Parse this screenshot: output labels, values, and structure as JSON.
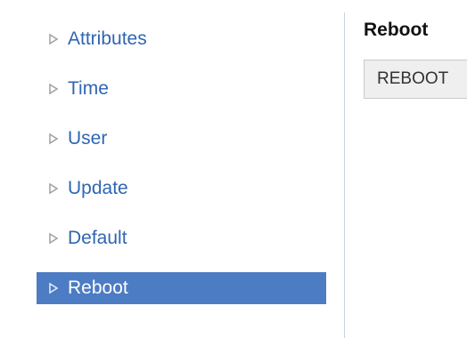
{
  "sidebar": {
    "items": [
      {
        "label": "Attributes",
        "icon": "triangle-right-icon",
        "active": false
      },
      {
        "label": "Time",
        "icon": "triangle-right-icon",
        "active": false
      },
      {
        "label": "User",
        "icon": "triangle-right-icon",
        "active": false
      },
      {
        "label": "Update",
        "icon": "triangle-right-icon",
        "active": false
      },
      {
        "label": "Default",
        "icon": "triangle-right-icon",
        "active": false
      },
      {
        "label": "Reboot",
        "icon": "triangle-right-icon",
        "active": true
      }
    ]
  },
  "main": {
    "title": "Reboot",
    "button_label": "REBOOT"
  },
  "colors": {
    "link": "#2f66b3",
    "active_bg": "#4c7cc4",
    "active_text": "#ffffff",
    "button_bg": "#efefef"
  }
}
